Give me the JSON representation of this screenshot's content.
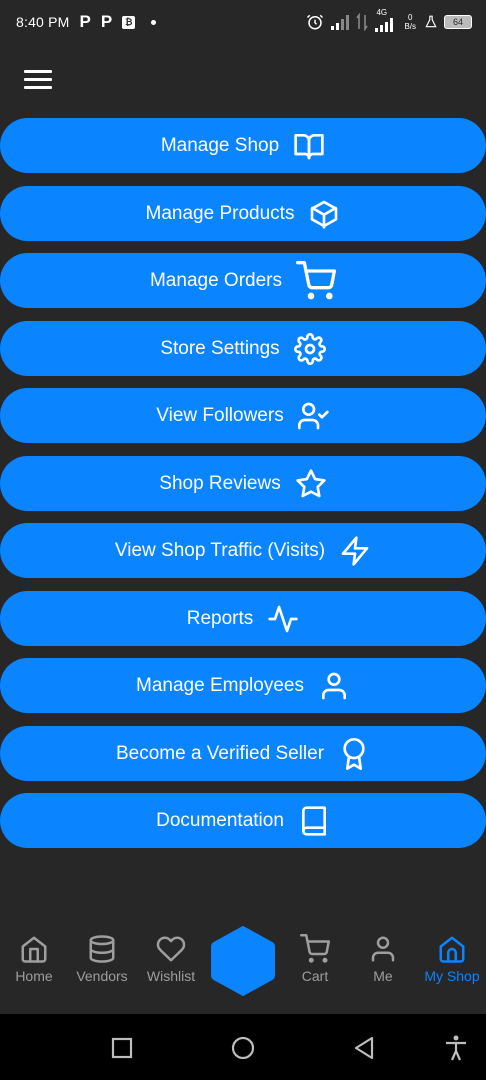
{
  "status_bar": {
    "time": "8:40 PM",
    "app_icons": [
      "P",
      "P"
    ],
    "network": "4G",
    "battery": "64",
    "data_rate_top": "0",
    "data_rate_bottom": "B/s"
  },
  "actions": [
    {
      "label": "Manage Shop",
      "icon": "book-open-icon"
    },
    {
      "label": "Manage Products",
      "icon": "box-icon"
    },
    {
      "label": "Manage Orders",
      "icon": "cart-icon"
    },
    {
      "label": "Store Settings",
      "icon": "gear-icon"
    },
    {
      "label": "View Followers",
      "icon": "user-check-icon"
    },
    {
      "label": "Shop Reviews",
      "icon": "star-icon"
    },
    {
      "label": "View Shop Traffic (Visits)",
      "icon": "lightning-icon"
    },
    {
      "label": "Reports",
      "icon": "activity-icon"
    },
    {
      "label": "Manage Employees",
      "icon": "user-icon"
    },
    {
      "label": "Become a Verified Seller",
      "icon": "award-icon"
    },
    {
      "label": "Documentation",
      "icon": "book-icon"
    }
  ],
  "bottom_nav": [
    {
      "label": "Home",
      "icon": "home-icon",
      "active": false
    },
    {
      "label": "Vendors",
      "icon": "database-icon",
      "active": false
    },
    {
      "label": "Wishlist",
      "icon": "heart-icon",
      "active": false
    },
    {
      "label": "Cart",
      "icon": "cart-icon",
      "active": false
    },
    {
      "label": "Me",
      "icon": "user-icon",
      "active": false
    },
    {
      "label": "My Shop",
      "icon": "shop-icon",
      "active": true
    }
  ],
  "colors": {
    "background": "#272727",
    "accent": "#0a84ff",
    "inactive": "#9e9e9e"
  }
}
